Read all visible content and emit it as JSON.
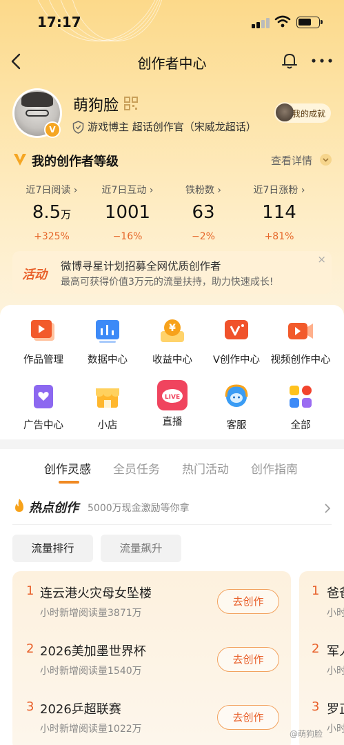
{
  "status_bar": {
    "time": "17:17"
  },
  "nav": {
    "title": "创作者中心"
  },
  "profile": {
    "name": "萌狗脸",
    "tagline": "游戏博主 超话创作官（宋威龙超话）",
    "badge": "V",
    "achievement": "我的成就"
  },
  "level": {
    "title": "我的创作者等级",
    "more": "查看详情"
  },
  "stats": [
    {
      "label": "近7日阅读 ›",
      "value": "8.5",
      "unit": "万",
      "change": "+325%"
    },
    {
      "label": "近7日互动 ›",
      "value": "1001",
      "unit": "",
      "change": "−16%"
    },
    {
      "label": "铁粉数 ›",
      "value": "63",
      "unit": "",
      "change": "−2%"
    },
    {
      "label": "近7日涨粉 ›",
      "value": "114",
      "unit": "",
      "change": "+81%"
    }
  ],
  "banner": {
    "tag": "活动",
    "line1": "微博寻星计划招募全网优质创作者",
    "line2": "最高可获得价值3万元的流量扶持，助力快速成长!",
    "close": "×"
  },
  "grid": [
    {
      "label": "作品管理",
      "icon": "works-icon"
    },
    {
      "label": "数据中心",
      "icon": "data-icon"
    },
    {
      "label": "收益中心",
      "icon": "income-icon"
    },
    {
      "label": "V创作中心",
      "icon": "v-create-icon"
    },
    {
      "label": "视频创作中心",
      "icon": "video-icon"
    },
    {
      "label": "广告中心",
      "icon": "ad-icon"
    },
    {
      "label": "小店",
      "icon": "shop-icon"
    },
    {
      "label": "直播",
      "icon": "live-icon",
      "badge": "LIVE"
    },
    {
      "label": "客服",
      "icon": "service-icon"
    },
    {
      "label": "全部",
      "icon": "all-icon"
    }
  ],
  "tabs": [
    "创作灵感",
    "全员任务",
    "热门活动",
    "创作指南"
  ],
  "hot": {
    "title": "热点创作",
    "subtitle": "5000万现金激励等你拿"
  },
  "pills": [
    "流量排行",
    "流量飙升"
  ],
  "hot_list": [
    {
      "rank": "1",
      "title": "连云港火灾母女坠楼",
      "sub": "小时新增阅读量3871万",
      "button": "去创作"
    },
    {
      "rank": "2",
      "title": "2026美加墨世界杯",
      "sub": "小时新增阅读量1540万",
      "button": "去创作"
    },
    {
      "rank": "3",
      "title": "2026乒超联赛",
      "sub": "小时新增阅读量1022万",
      "button": "去创作"
    }
  ],
  "peek_list": [
    {
      "rank": "1",
      "title": "爸爸",
      "sub": "小时"
    },
    {
      "rank": "2",
      "title": "军人",
      "sub": "小时"
    },
    {
      "rank": "3",
      "title": "罗正",
      "sub": "小时"
    }
  ],
  "watermark": "@萌狗脸",
  "colors": {
    "accent": "#e8602a",
    "tab_indicator": "#f08a24",
    "header_bg": "#fcd98a"
  }
}
